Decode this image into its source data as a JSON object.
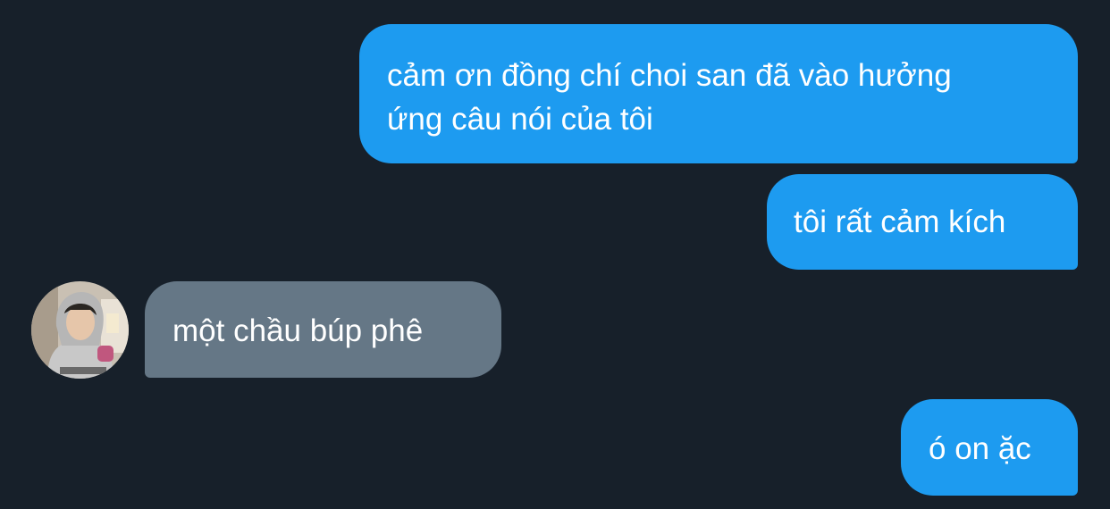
{
  "colors": {
    "background": "#17202a",
    "outgoing_bubble": "#1d9bf0",
    "incoming_bubble": "#657786",
    "text": "#ffffff"
  },
  "messages": [
    {
      "direction": "outgoing",
      "lines": [
        "cảm ơn đồng chí choi san đã vào hưởng",
        "ứng câu nói của tôi"
      ]
    },
    {
      "direction": "outgoing",
      "lines": [
        "tôi rất cảm kích"
      ]
    },
    {
      "direction": "incoming",
      "lines": [
        "một chầu búp phê"
      ],
      "avatar": "user-avatar-photo"
    },
    {
      "direction": "outgoing",
      "lines": [
        "ó on ặc"
      ]
    }
  ]
}
